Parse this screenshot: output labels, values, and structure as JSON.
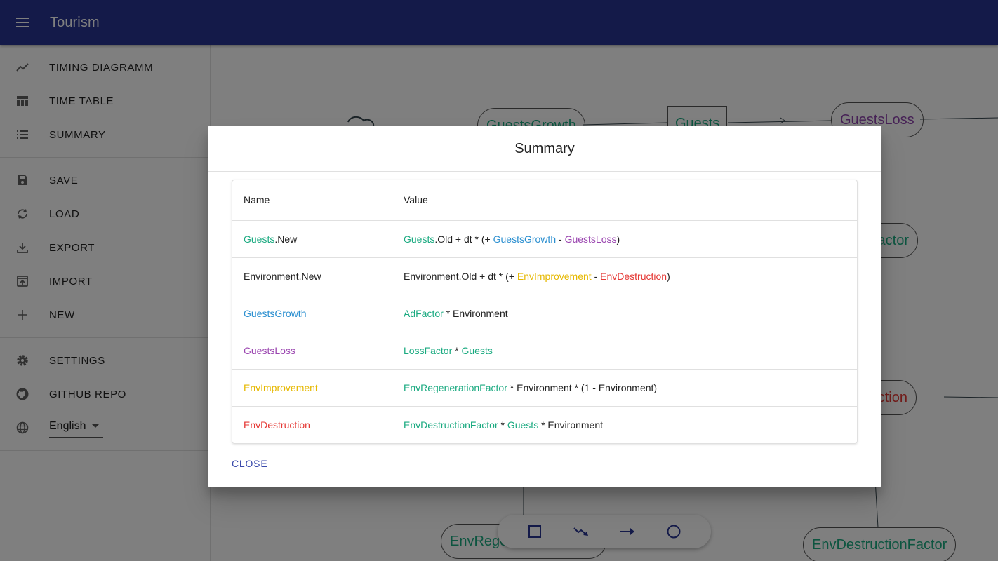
{
  "app": {
    "title": "Tourism"
  },
  "drawer": {
    "section1": [
      {
        "label": "TIMING DIAGRAMM",
        "icon": "trending-icon"
      },
      {
        "label": "TIME TABLE",
        "icon": "table-icon"
      },
      {
        "label": "SUMMARY",
        "icon": "list-icon"
      }
    ],
    "section2": [
      {
        "label": "SAVE",
        "icon": "save-icon"
      },
      {
        "label": "LOAD",
        "icon": "refresh-icon"
      },
      {
        "label": "EXPORT",
        "icon": "download-icon"
      },
      {
        "label": "IMPORT",
        "icon": "import-icon"
      },
      {
        "label": "NEW",
        "icon": "plus-icon"
      }
    ],
    "section3": [
      {
        "label": "SETTINGS",
        "icon": "gear-icon"
      },
      {
        "label": "GITHUB REPO",
        "icon": "github-icon"
      }
    ],
    "language": {
      "selected": "English",
      "icon": "globe-icon"
    }
  },
  "canvas": {
    "nodes": {
      "guests_growth": "GuestsGrowth",
      "guests": "Guests",
      "guests_loss": "GuestsLoss",
      "factor_partial": "actor",
      "destruction_partial": "uction",
      "env_regen_partial": "EnvRege",
      "env_destruction_factor": "EnvDestructionFactor"
    },
    "tools": [
      "square-icon",
      "flow-icon",
      "arrow-right-icon",
      "circle-icon"
    ]
  },
  "dialog": {
    "title": "Summary",
    "headers": {
      "name": "Name",
      "value": "Value"
    },
    "rows": [
      {
        "name": [
          [
            "Guests",
            "green"
          ],
          [
            ".New",
            ""
          ]
        ],
        "value": [
          [
            "Guests",
            "green"
          ],
          [
            ".Old + dt * (+ ",
            ""
          ],
          [
            "GuestsGrowth",
            "blue"
          ],
          [
            " - ",
            ""
          ],
          [
            "GuestsLoss",
            "purple"
          ],
          [
            ")",
            ""
          ]
        ]
      },
      {
        "name": [
          [
            "Environment.New",
            ""
          ]
        ],
        "value": [
          [
            "Environment.Old + dt * (+ ",
            ""
          ],
          [
            "EnvImprovement",
            "yellow"
          ],
          [
            " - ",
            ""
          ],
          [
            "EnvDestruction",
            "red"
          ],
          [
            ")",
            ""
          ]
        ]
      },
      {
        "name": [
          [
            "GuestsGrowth",
            "blue"
          ]
        ],
        "value": [
          [
            "AdFactor",
            "green"
          ],
          [
            " * Environment",
            ""
          ]
        ]
      },
      {
        "name": [
          [
            "GuestsLoss",
            "purple"
          ]
        ],
        "value": [
          [
            "LossFactor",
            "green"
          ],
          [
            " * ",
            ""
          ],
          [
            "Guests",
            "green"
          ]
        ]
      },
      {
        "name": [
          [
            "EnvImprovement",
            "yellow"
          ]
        ],
        "value": [
          [
            "EnvRegenerationFactor",
            "green"
          ],
          [
            " * Environment * (1 - Environment)",
            ""
          ]
        ]
      },
      {
        "name": [
          [
            "EnvDestruction",
            "red"
          ]
        ],
        "value": [
          [
            "EnvDestructionFactor",
            "green"
          ],
          [
            " * ",
            ""
          ],
          [
            "Guests",
            "green"
          ],
          [
            " * Environment",
            ""
          ]
        ]
      }
    ],
    "close_label": "CLOSE"
  },
  "colors": {
    "appbar": "#283593",
    "green": "#1aaa80",
    "blue": "#2b8fd0",
    "purple": "#9b46b0",
    "yellow": "#e6b800",
    "red": "#e53935",
    "button": "#3949ab"
  }
}
